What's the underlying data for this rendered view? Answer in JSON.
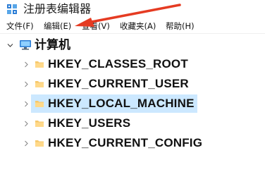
{
  "window": {
    "title": "注册表编辑器"
  },
  "menu": {
    "items": [
      {
        "label": "文件(F)"
      },
      {
        "label": "编辑(E)"
      },
      {
        "label": "查看(V)"
      },
      {
        "label": "收藏夹(A)"
      },
      {
        "label": "帮助(H)"
      }
    ]
  },
  "tree": {
    "root": {
      "label": "计算机",
      "icon": "computer-icon",
      "expanded": true
    },
    "keys": [
      {
        "label": "HKEY_CLASSES_ROOT",
        "icon": "folder-icon",
        "selected": false
      },
      {
        "label": "HKEY_CURRENT_USER",
        "icon": "folder-icon",
        "selected": false
      },
      {
        "label": "HKEY_LOCAL_MACHINE",
        "icon": "folder-icon",
        "selected": true
      },
      {
        "label": "HKEY_USERS",
        "icon": "folder-icon",
        "selected": false
      },
      {
        "label": "HKEY_CURRENT_CONFIG",
        "icon": "folder-icon",
        "selected": false
      }
    ]
  },
  "colors": {
    "selection": "#cce8ff",
    "folder": "#f5c86b",
    "annotation_arrow": "#e53b22"
  }
}
